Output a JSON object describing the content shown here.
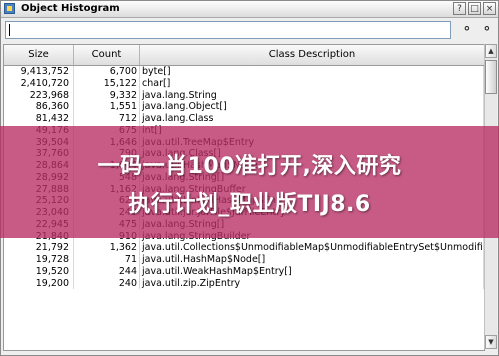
{
  "window": {
    "title": "Object Histogram",
    "controls": [
      "?",
      "□",
      "×"
    ]
  },
  "toolbar": {
    "search_value": "",
    "find_icon": "binoculars-icon",
    "find_next_icon": "binoculars-icon"
  },
  "table": {
    "columns": [
      "Size",
      "Count",
      "Class Description"
    ],
    "rows": [
      {
        "size": "9,413,752",
        "count": "6,700",
        "desc": "byte[]"
      },
      {
        "size": "2,410,720",
        "count": "15,122",
        "desc": "char[]"
      },
      {
        "size": "223,968",
        "count": "9,332",
        "desc": "java.lang.String"
      },
      {
        "size": "86,360",
        "count": "1,551",
        "desc": "java.lang.Object[]"
      },
      {
        "size": "81,432",
        "count": "712",
        "desc": "java.lang.Class"
      },
      {
        "size": "49,176",
        "count": "675",
        "desc": "int[]"
      },
      {
        "size": "39,504",
        "count": "1,646",
        "desc": "java.util.TreeMap$Entry"
      },
      {
        "size": "37,760",
        "count": "790",
        "desc": "java.lang.Class[]"
      },
      {
        "size": "28,864",
        "count": "1,804",
        "desc": "java.util.HashMap$Node"
      },
      {
        "size": "28,992",
        "count": "548",
        "desc": "java.lang.String[]"
      },
      {
        "size": "27,888",
        "count": "1,162",
        "desc": "java.lang.StringBuffer"
      },
      {
        "size": "25,120",
        "count": "628",
        "desc": "java.util.LinkedHashMap$Entry"
      },
      {
        "size": "23,040",
        "count": "240",
        "desc": "java.util.jar.JarFile$JarFileEntry"
      },
      {
        "size": "22,945",
        "count": "475",
        "desc": "java.lang.String[]"
      },
      {
        "size": "21,840",
        "count": "910",
        "desc": "java.lang.StringBuilder"
      },
      {
        "size": "21,792",
        "count": "1,362",
        "desc": "java.util.Collections$UnmodifiableMap$UnmodifiableEntrySet$UnmodifiableE"
      },
      {
        "size": "19,728",
        "count": "71",
        "desc": "java.util.HashMap$Node[]"
      },
      {
        "size": "19,520",
        "count": "244",
        "desc": "java.util.WeakHashMap$Entry[]"
      },
      {
        "size": "19,200",
        "count": "240",
        "desc": "java.util.zip.ZipEntry"
      }
    ]
  },
  "overlay": {
    "line1": "一码一肖100准打开,深入研究",
    "line2": "执行计划_职业版TIJ8.6"
  }
}
